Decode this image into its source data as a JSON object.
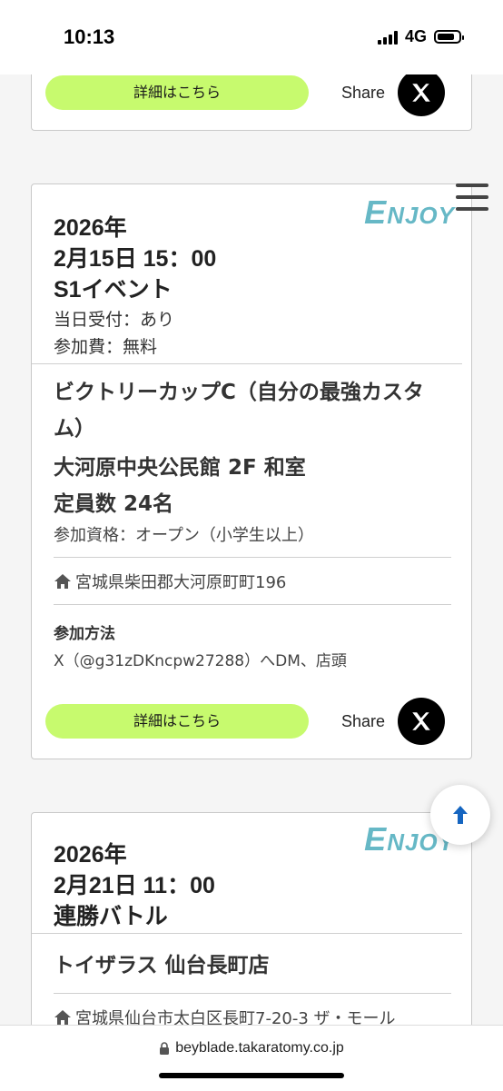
{
  "status": {
    "time": "10:13",
    "network": "4G"
  },
  "card1": {
    "detail_label": "詳細はこちら",
    "share_label": "Share"
  },
  "card2": {
    "enjoy_big": "E",
    "enjoy_small": "NJOY",
    "year": "2026年",
    "datetime": "2月15日 15：00",
    "event_type": "S1イベント",
    "same_day": "当日受付：あり",
    "fee": "参加費：無料",
    "name": "ビクトリーカップC（自分の最強カスタム）",
    "venue": "大河原中央公民館 2F 和室",
    "capacity": "定員数 24名",
    "qualification": "参加資格：オープン（小学生以上）",
    "address": "宮城県柴田郡大河原町町196",
    "method_label": "参加方法",
    "method": "X（@g31zDKncpw27288）へDM、店頭",
    "detail_label": "詳細はこちら",
    "share_label": "Share"
  },
  "card3": {
    "enjoy_big": "E",
    "enjoy_small": "NJOY",
    "year": "2026年",
    "datetime": "2月21日 11：00",
    "event_type": "連勝バトル",
    "venue": "トイザラス 仙台長町店",
    "address": "宮城県仙台市太白区長町7-20-3 ザ・モール"
  },
  "url_bar": {
    "domain": "beyblade.takaratomy.co.jp"
  },
  "icons": [
    "home-icon",
    "x-logo-icon",
    "menu-icon",
    "arrow-up-icon",
    "lock-icon"
  ],
  "colors": {
    "accent_green": "#c7fa6e",
    "enjoy_teal": "#66b8c6",
    "top_arrow": "#1565c0"
  }
}
